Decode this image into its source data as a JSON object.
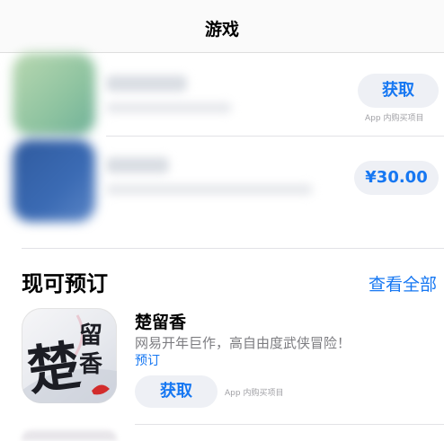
{
  "header": {
    "title": "游戏"
  },
  "rows": [
    {
      "button": "获取",
      "note": "App 内购买项目"
    },
    {
      "button": "¥30.00"
    }
  ],
  "section": {
    "title": "现可预订",
    "see_all": "查看全部",
    "app": {
      "name": "楚留香",
      "subtitle": "网易开年巨作，高自由度武侠冒险！",
      "badge": "预订",
      "button": "获取",
      "note": "App 内购买项目",
      "icon_glyphs": [
        "楚",
        "留",
        "香"
      ]
    }
  },
  "colors": {
    "accent": "#1677f2",
    "pill_bg": "#eef0f5"
  },
  "icons": {
    "app_logo": "chuliuxiang-calligraphy-icon",
    "netease_mark": "netease-logo-icon"
  }
}
